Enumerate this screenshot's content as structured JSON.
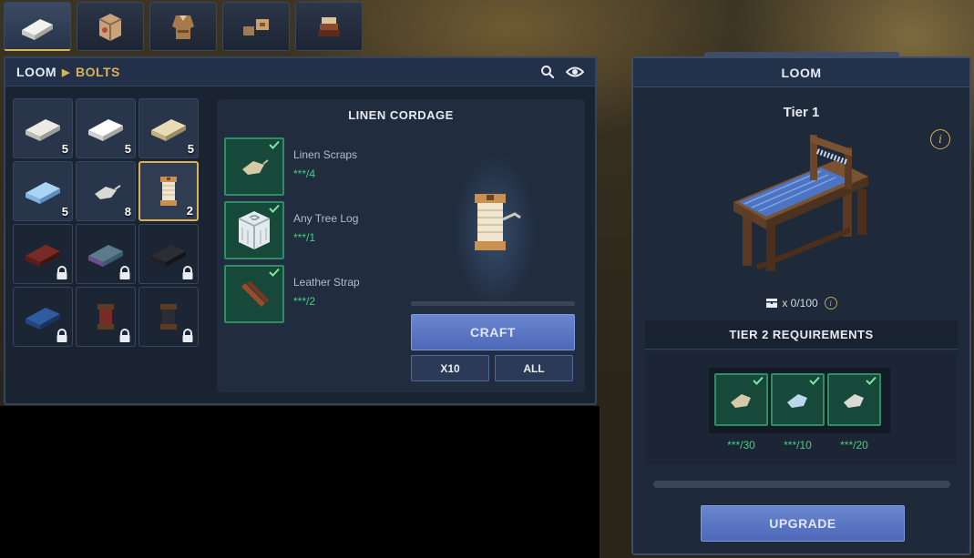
{
  "colors": {
    "accent_gold": "#d9b257",
    "check_green": "#45d07c",
    "button_blue": "#5873c2",
    "panel_bg": "#1a2332"
  },
  "station_tabs": [
    {
      "icon": "linen-bolt-icon",
      "active": true
    },
    {
      "icon": "woven-crate-icon",
      "active": false
    },
    {
      "icon": "clothing-icon",
      "active": false
    },
    {
      "icon": "accessories-icon",
      "active": false
    },
    {
      "icon": "book-stack-icon",
      "active": false
    }
  ],
  "crafting": {
    "breadcrumb": {
      "station": "LOOM",
      "category": "BOLTS"
    },
    "header_icons": [
      "search-icon",
      "eye-icon"
    ],
    "grid": [
      {
        "icon": "linen-bolt-icon",
        "count": "5",
        "locked": false
      },
      {
        "icon": "white-bolt-icon",
        "count": "5",
        "locked": false
      },
      {
        "icon": "canvas-bolt-icon",
        "count": "5",
        "locked": false
      },
      {
        "icon": "silk-bolt-icon",
        "count": "5",
        "locked": false
      },
      {
        "icon": "linen-scraps-icon",
        "count": "8",
        "locked": false
      },
      {
        "icon": "linen-cordage-icon",
        "count": "2",
        "locked": false,
        "selected": true
      },
      {
        "icon": "red-bolt-icon",
        "count": "",
        "locked": true
      },
      {
        "icon": "iridescent-bolt-icon",
        "count": "",
        "locked": true
      },
      {
        "icon": "dark-bolt-icon",
        "count": "",
        "locked": true
      },
      {
        "icon": "blue-bolt-icon",
        "count": "",
        "locked": true
      },
      {
        "icon": "red-spool-icon",
        "count": "",
        "locked": true
      },
      {
        "icon": "dark-spool-icon",
        "count": "",
        "locked": true
      }
    ],
    "recipe": {
      "title": "LINEN CORDAGE",
      "ingredients": [
        {
          "name": "Linen Scraps",
          "qty": "***/4",
          "icon": "linen-scraps-icon"
        },
        {
          "name": "Any Tree Log",
          "qty": "***/1",
          "icon": "tree-log-icon"
        },
        {
          "name": "Leather Strap",
          "qty": "***/2",
          "icon": "leather-strap-icon"
        }
      ],
      "result_icon": "linen-cordage-icon",
      "craft_label": "CRAFT",
      "x10_label": "X10",
      "all_label": "ALL"
    }
  },
  "loom_panel": {
    "title": "LOOM",
    "tier": "Tier 1",
    "info_symbol": "i",
    "storage": "x 0/100",
    "requirements_title": "TIER 2 REQUIREMENTS",
    "requirements": [
      {
        "icon": "linen-scraps-icon",
        "qty": "***/30"
      },
      {
        "icon": "silk-scraps-icon",
        "qty": "***/10"
      },
      {
        "icon": "wool-scraps-icon",
        "qty": "***/20"
      }
    ],
    "upgrade_label": "UPGRADE"
  }
}
